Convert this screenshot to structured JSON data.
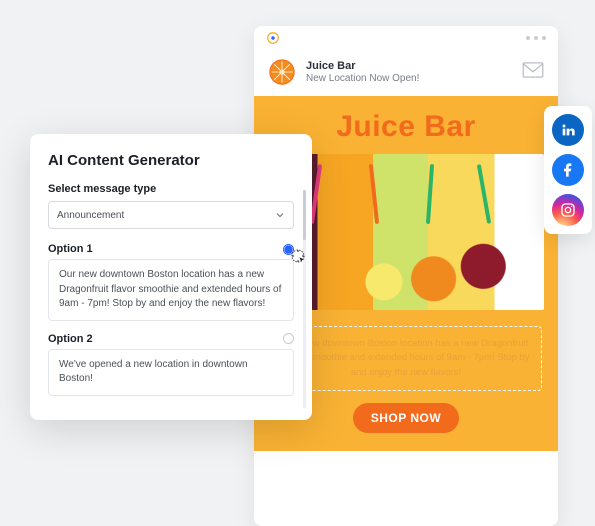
{
  "email": {
    "sender_name": "Juice Bar",
    "sender_subject": "New Location Now Open!",
    "hero_title": "Juice Bar",
    "description": "Our new downtown Boston location has a new Dragonfruit flavor smoothie and extended hours of 9am - 7pm! Stop by and enjoy the new flavors!",
    "cta": "SHOP NOW"
  },
  "ai_generator": {
    "title": "AI Content Generator",
    "select_label": "Select message type",
    "select_value": "Announcement",
    "options": [
      {
        "label": "Option 1",
        "text": "Our new downtown Boston location has a new Dragonfruit flavor smoothie and extended hours of 9am - 7pm! Stop by and enjoy the new flavors!",
        "selected": true
      },
      {
        "label": "Option 2",
        "text": "We've opened a new location in downtown Boston!",
        "selected": false
      }
    ]
  },
  "social": {
    "linkedin": "LinkedIn",
    "facebook": "Facebook",
    "instagram": "Instagram"
  }
}
